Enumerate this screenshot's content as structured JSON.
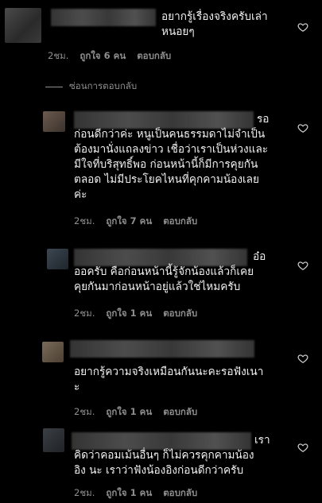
{
  "comments": [
    {
      "text": "อยากรู้เรื่องจริงครับเล่า\nหนอยๆ",
      "time": "2ชม.",
      "likes": "ถูกใจ 6 คน",
      "reply": "ตอบกลับ"
    },
    {
      "text": "รอ\nก่อนดีกว่าค่ะ หนูเป็นคนธรรมดาไม่จำเป็น\nต้องมานั่งแถลงข่าว เชื่อว่าเราเป็นห่วงและ\nมีใจที่บริสุทธิ์พอ ก่อนหน้านี้ก็มีการคุยกัน\nตลอด ไม่มีประโยคไหนที่คุกคามน้องเลย\nค่ะ",
      "time": "2ชม.",
      "likes": "ถูกใจ 7 คน",
      "reply": "ตอบกลับ"
    },
    {
      "text": "อ๋อ\nออครับ คือก่อนหน้านี้รู้จักน้องแล้วก็เคย\nคุยกันมาก่อนหน้าอยู่แล้วใช่ไหมครับ",
      "time": "2ชม.",
      "likes": "ถูกใจ 1 คน",
      "reply": "ตอบกลับ"
    },
    {
      "text": "อยากรู้ความจริงเหมือนกันนะคะรอฟังเนา\nะ",
      "time": "2ชม.",
      "likes": "ถูกใจ 1 คน",
      "reply": "ตอบกลับ"
    },
    {
      "text": "เรา\nคิดว่าคอมเม้นอื่นๆ ก็ไม่ควรคุกคามน้อง\nอิง นะ เราว่าฟังน้องอิงก่อนดีกว่าครับ",
      "time": "2ชม.",
      "likes": "ถูกใจ 1 คน",
      "reply": "ตอบกลับ"
    }
  ],
  "hide_replies": "ซ่อนการตอบกลับ"
}
